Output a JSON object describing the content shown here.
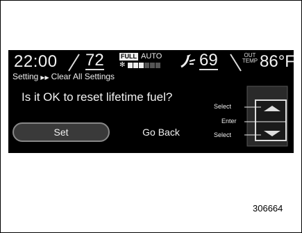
{
  "status": {
    "time": "22:00",
    "driver_temp": "72",
    "fan_label_full": "FULL",
    "fan_label_auto": "AUTO",
    "fan_level": 0.5,
    "airflow_icon": "airflow-mode-icon",
    "passenger_temp": "69",
    "out_temp_label_line1": "OUT",
    "out_temp_label_line2": "TEMP",
    "outside_temp": "86°F"
  },
  "breadcrumb": {
    "parent": "Setting",
    "current": "Clear All Settings"
  },
  "dialog": {
    "question": "Is it OK to reset lifetime fuel?",
    "set_label": "Set",
    "back_label": "Go Back"
  },
  "controller": {
    "select_up_label": "Select",
    "enter_label": "Enter",
    "select_down_label": "Select"
  },
  "figure_id": "306664",
  "colors": {
    "screen_bg": "#000000",
    "text": "#f2f2f2",
    "button_bg": "#3a3a3a"
  }
}
